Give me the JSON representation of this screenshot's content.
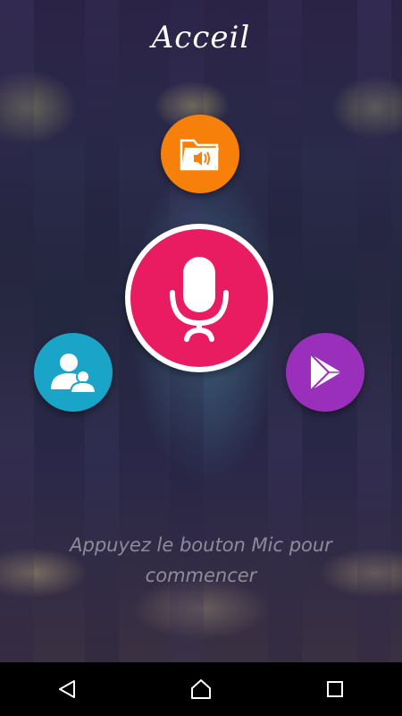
{
  "screen": {
    "title": "Acceil",
    "hint": "Appuyez le bouton Mic pour commencer"
  },
  "buttons": {
    "files": {
      "icon": "audio-folder-icon",
      "color": "#f7800b"
    },
    "mic": {
      "icon": "microphone-icon",
      "color": "#e91c62",
      "ring": "#ffffff"
    },
    "contacts": {
      "icon": "contacts-icon",
      "color": "#1aa4c8"
    },
    "play": {
      "icon": "play-store-icon",
      "color": "#9a2fbc"
    }
  },
  "navbar": {
    "back": "back-icon",
    "home": "home-icon",
    "recents": "recents-icon"
  }
}
